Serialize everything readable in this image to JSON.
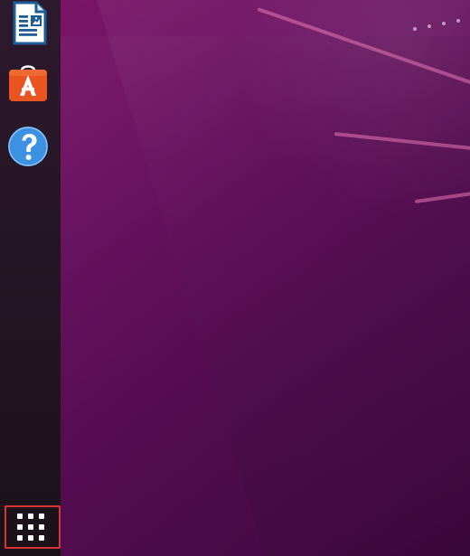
{
  "dock": {
    "items": [
      {
        "icon": "libreoffice-writer-icon"
      },
      {
        "icon": "ubuntu-software-icon"
      },
      {
        "icon": "help-icon"
      }
    ],
    "show_applications_icon": "apps-grid-icon"
  },
  "colors": {
    "desktop_primary": "#6b1262",
    "desktop_secondary": "#4b0a4b",
    "dock_background": "#241524",
    "highlight": "#d93333"
  }
}
